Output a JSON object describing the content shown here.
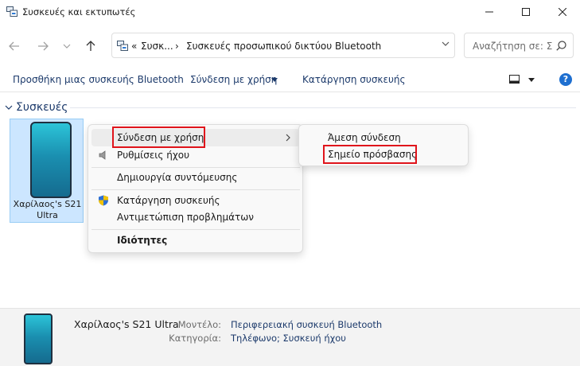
{
  "window": {
    "title": "Συσκευές και εκτυπωτές",
    "icon": "devices-printers-icon"
  },
  "address_bar": {
    "overflow": "«",
    "crumb_1": "Συσκ...",
    "separator": "›",
    "crumb_2": "Συσκευές προσωπικού δικτύου Bluetooth",
    "search_placeholder": "Αναζήτηση σε: Συσκευές προσωπικού δικτύου Bluetooth"
  },
  "command_bar": {
    "add_device": "Προσθήκη μιας συσκευής Bluetooth",
    "connect_using": "Σύνδεση με χρήση",
    "remove_device": "Κατάργηση συσκευής",
    "help": "?"
  },
  "group": {
    "label": "Συσκευές"
  },
  "device": {
    "name": "Χαρίλαος's S21 Ultra"
  },
  "context_menu": {
    "items": [
      {
        "label": "Σύνδεση με χρήση",
        "has_submenu": true
      },
      {
        "label": "Ρυθμίσεις ήχου",
        "icon": "speaker-icon"
      },
      {
        "label": "Δημιουργία συντόμευσης"
      },
      {
        "label": "Κατάργηση συσκευής",
        "icon": "shield-icon"
      },
      {
        "label": "Αντιμετώπιση προβλημάτων"
      },
      {
        "label": "Ιδιότητες",
        "bold": true
      }
    ]
  },
  "submenu": {
    "items": [
      {
        "label": "Άμεση σύνδεση"
      },
      {
        "label": "Σημείο πρόσβασης"
      }
    ]
  },
  "details": {
    "name": "Χαρίλαος's S21 Ultra",
    "model_label": "Μοντέλο:",
    "model_value": "Περιφερειακή συσκευή Bluetooth",
    "category_label": "Κατηγορία:",
    "category_value": "Τηλέφωνο; Συσκευή ήχου"
  },
  "colors": {
    "highlight_box": "#e0141b",
    "link_text": "#1c3a6b",
    "selection": "#cce6ff",
    "help_badge": "#1e6fd0"
  }
}
